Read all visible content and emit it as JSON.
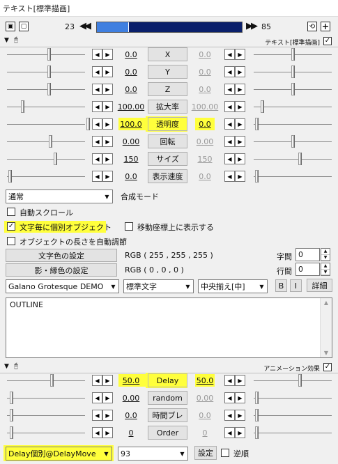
{
  "window": {
    "title": "テキスト[標準描画]"
  },
  "timeline": {
    "start": "23",
    "end": "85",
    "progress": 0.22
  },
  "header1": {
    "label": "テキスト[標準描画]"
  },
  "tracks": [
    {
      "name": "X",
      "left": "0.0",
      "right": "0.0",
      "highlight": false
    },
    {
      "name": "Y",
      "left": "0.0",
      "right": "0.0",
      "highlight": false
    },
    {
      "name": "Z",
      "left": "0.0",
      "right": "0.0",
      "highlight": false
    },
    {
      "name": "拡大率",
      "left": "100.00",
      "right": "100.00",
      "highlight": false
    },
    {
      "name": "透明度",
      "left": "100.0",
      "right": "0.0",
      "highlight": true
    },
    {
      "name": "回転",
      "left": "0.00",
      "right": "0.00",
      "highlight": false
    },
    {
      "name": "サイズ",
      "left": "150",
      "right": "150",
      "highlight": false
    },
    {
      "name": "表示速度",
      "left": "0.0",
      "right": "0.0",
      "highlight": false
    }
  ],
  "blend": {
    "value": "通常",
    "label": "合成モード"
  },
  "options": {
    "auto_scroll": "自動スクロール",
    "per_char": "文字毎に個別オブジェクト",
    "show_on_move": "移動座標上に表示する",
    "auto_length": "オブジェクトの長さを自動調節"
  },
  "colors": {
    "text_color_btn": "文字色の設定",
    "text_color_val": "RGB ( 255 , 255 , 255 )",
    "shadow_btn": "影・縁色の設定",
    "shadow_val": "RGB ( 0 , 0 , 0 )",
    "char_spacing_label": "字間",
    "char_spacing": "0",
    "line_spacing_label": "行間",
    "line_spacing": "0",
    "highlight": "#ffff3c",
    "timeline_blue": "#3f7fe0",
    "timeline_navy": "#0a1f6b"
  },
  "font": {
    "family": "Galano Grotesque DEMO",
    "style": "標準文字",
    "align": "中央揃え[中]",
    "bold": "B",
    "italic": "I",
    "detail": "詳細"
  },
  "text_content": "OUTLINE",
  "header2": {
    "label": "アニメーション効果"
  },
  "anim_tracks": [
    {
      "name": "Delay",
      "left": "50.0",
      "right": "50.0",
      "highlight": true
    },
    {
      "name": "random",
      "left": "0.00",
      "right": "0.00",
      "highlight": false
    },
    {
      "name": "時間ブレ",
      "left": "0.0",
      "right": "0.0",
      "highlight": false
    },
    {
      "name": "Order",
      "left": "0",
      "right": "0",
      "highlight": false
    }
  ],
  "anim": {
    "effect": "Delay個別@DelayMove",
    "param": "93",
    "settings": "設定",
    "reverse": "逆順"
  }
}
